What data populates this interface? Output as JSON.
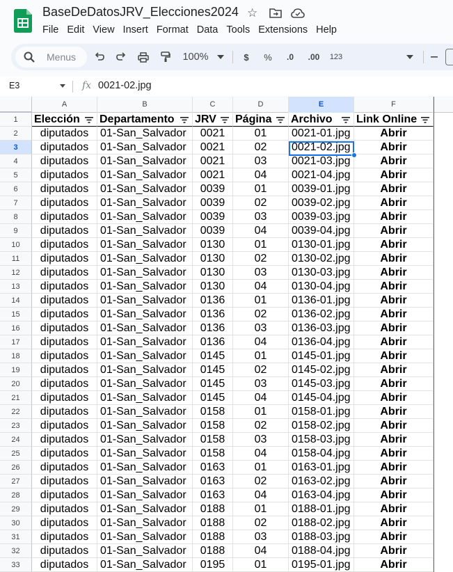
{
  "app": {
    "title": "BaseDeDatosJRV_Elecciones2024",
    "menus": [
      "File",
      "Edit",
      "View",
      "Insert",
      "Format",
      "Data",
      "Tools",
      "Extensions",
      "Help"
    ]
  },
  "toolbar": {
    "search_placeholder": "Menus",
    "zoom": "100%",
    "currency": "$",
    "percent": "%",
    "dec_decrease": ".0",
    "dec_increase": ".00",
    "number_format": "123"
  },
  "formula_bar": {
    "cell_ref": "E3",
    "fx": "fx",
    "content": "0021-02.jpg"
  },
  "columns": [
    "A",
    "B",
    "C",
    "D",
    "E",
    "F"
  ],
  "selected_column": "E",
  "selected_row": 3,
  "header_row": [
    "Elección",
    "Departamento",
    "JRV",
    "Página",
    "Archivo",
    "Link Online"
  ],
  "rows": [
    [
      "diputados",
      "01-San_Salvador",
      "0021",
      "01",
      "0021-01.jpg",
      "Abrir"
    ],
    [
      "diputados",
      "01-San_Salvador",
      "0021",
      "02",
      "0021-02.jpg",
      "Abrir"
    ],
    [
      "diputados",
      "01-San_Salvador",
      "0021",
      "03",
      "0021-03.jpg",
      "Abrir"
    ],
    [
      "diputados",
      "01-San_Salvador",
      "0021",
      "04",
      "0021-04.jpg",
      "Abrir"
    ],
    [
      "diputados",
      "01-San_Salvador",
      "0039",
      "01",
      "0039-01.jpg",
      "Abrir"
    ],
    [
      "diputados",
      "01-San_Salvador",
      "0039",
      "02",
      "0039-02.jpg",
      "Abrir"
    ],
    [
      "diputados",
      "01-San_Salvador",
      "0039",
      "03",
      "0039-03.jpg",
      "Abrir"
    ],
    [
      "diputados",
      "01-San_Salvador",
      "0039",
      "04",
      "0039-04.jpg",
      "Abrir"
    ],
    [
      "diputados",
      "01-San_Salvador",
      "0130",
      "01",
      "0130-01.jpg",
      "Abrir"
    ],
    [
      "diputados",
      "01-San_Salvador",
      "0130",
      "02",
      "0130-02.jpg",
      "Abrir"
    ],
    [
      "diputados",
      "01-San_Salvador",
      "0130",
      "03",
      "0130-03.jpg",
      "Abrir"
    ],
    [
      "diputados",
      "01-San_Salvador",
      "0130",
      "04",
      "0130-04.jpg",
      "Abrir"
    ],
    [
      "diputados",
      "01-San_Salvador",
      "0136",
      "01",
      "0136-01.jpg",
      "Abrir"
    ],
    [
      "diputados",
      "01-San_Salvador",
      "0136",
      "02",
      "0136-02.jpg",
      "Abrir"
    ],
    [
      "diputados",
      "01-San_Salvador",
      "0136",
      "03",
      "0136-03.jpg",
      "Abrir"
    ],
    [
      "diputados",
      "01-San_Salvador",
      "0136",
      "04",
      "0136-04.jpg",
      "Abrir"
    ],
    [
      "diputados",
      "01-San_Salvador",
      "0145",
      "01",
      "0145-01.jpg",
      "Abrir"
    ],
    [
      "diputados",
      "01-San_Salvador",
      "0145",
      "02",
      "0145-02.jpg",
      "Abrir"
    ],
    [
      "diputados",
      "01-San_Salvador",
      "0145",
      "03",
      "0145-03.jpg",
      "Abrir"
    ],
    [
      "diputados",
      "01-San_Salvador",
      "0145",
      "04",
      "0145-04.jpg",
      "Abrir"
    ],
    [
      "diputados",
      "01-San_Salvador",
      "0158",
      "01",
      "0158-01.jpg",
      "Abrir"
    ],
    [
      "diputados",
      "01-San_Salvador",
      "0158",
      "02",
      "0158-02.jpg",
      "Abrir"
    ],
    [
      "diputados",
      "01-San_Salvador",
      "0158",
      "03",
      "0158-03.jpg",
      "Abrir"
    ],
    [
      "diputados",
      "01-San_Salvador",
      "0158",
      "04",
      "0158-04.jpg",
      "Abrir"
    ],
    [
      "diputados",
      "01-San_Salvador",
      "0163",
      "01",
      "0163-01.jpg",
      "Abrir"
    ],
    [
      "diputados",
      "01-San_Salvador",
      "0163",
      "02",
      "0163-02.jpg",
      "Abrir"
    ],
    [
      "diputados",
      "01-San_Salvador",
      "0163",
      "04",
      "0163-04.jpg",
      "Abrir"
    ],
    [
      "diputados",
      "01-San_Salvador",
      "0188",
      "01",
      "0188-01.jpg",
      "Abrir"
    ],
    [
      "diputados",
      "01-San_Salvador",
      "0188",
      "02",
      "0188-02.jpg",
      "Abrir"
    ],
    [
      "diputados",
      "01-San_Salvador",
      "0188",
      "03",
      "0188-03.jpg",
      "Abrir"
    ],
    [
      "diputados",
      "01-San_Salvador",
      "0188",
      "04",
      "0188-04.jpg",
      "Abrir"
    ],
    [
      "diputados",
      "01-San_Salvador",
      "0195",
      "01",
      "0195-01.jpg",
      "Abrir"
    ]
  ]
}
